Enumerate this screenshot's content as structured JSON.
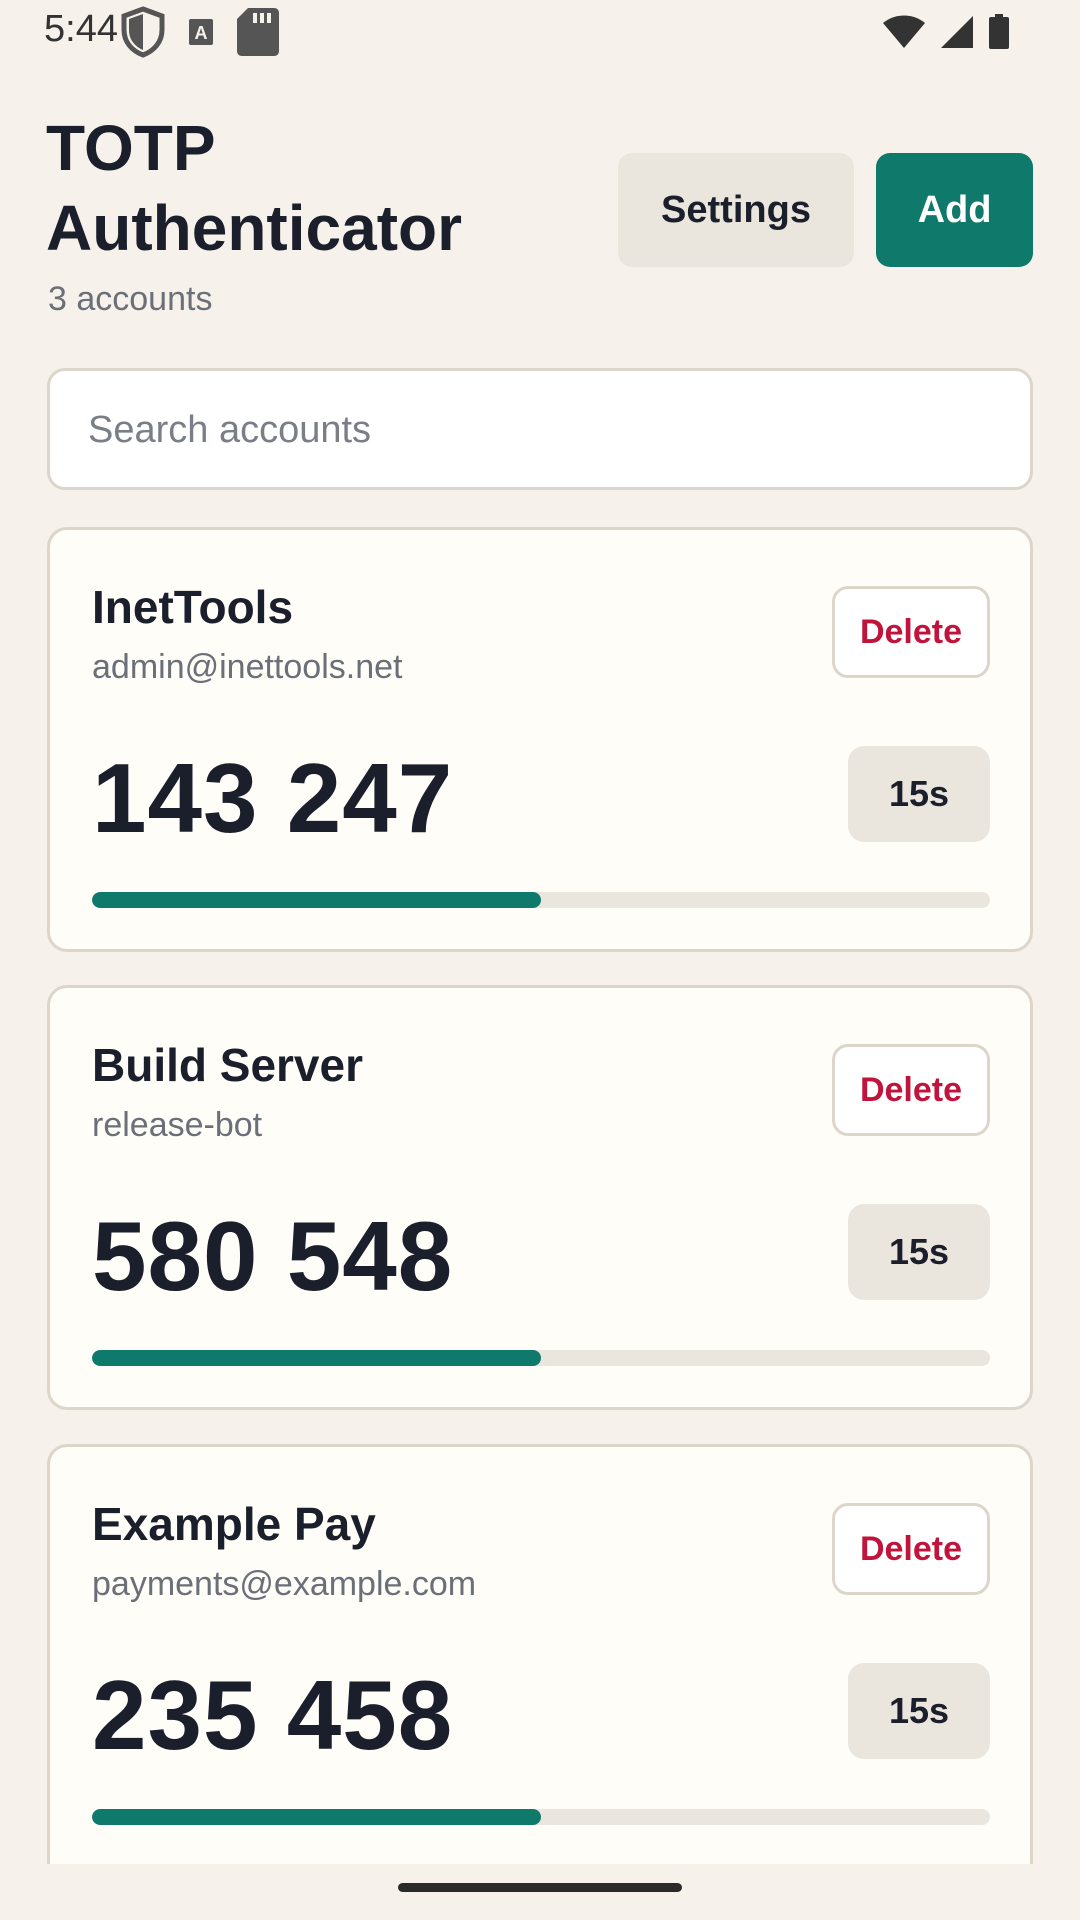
{
  "status_bar": {
    "time": "5:44",
    "left_icons": [
      "shield-icon",
      "font-a-icon",
      "sd-card-icon"
    ],
    "right_icons": [
      "wifi-icon",
      "cellular-signal-icon",
      "battery-icon"
    ]
  },
  "header": {
    "title": "TOTP Authenticator",
    "account_count": "3 accounts",
    "settings_label": "Settings",
    "add_label": "Add"
  },
  "search": {
    "placeholder": "Search accounts",
    "value": ""
  },
  "colors": {
    "background": "#f6f2eb",
    "accent": "#0f7a6c",
    "delete": "#c0143c",
    "text": "#1a1f2b",
    "muted": "#6b6f78"
  },
  "accounts": [
    {
      "issuer": "InetTools",
      "account": "admin@inettools.net",
      "code": "143 247",
      "timer": "15s",
      "progress": 0.5,
      "delete_label": "Delete"
    },
    {
      "issuer": "Build Server",
      "account": "release-bot",
      "code": "580 548",
      "timer": "15s",
      "progress": 0.5,
      "delete_label": "Delete"
    },
    {
      "issuer": "Example Pay",
      "account": "payments@example.com",
      "code": "235 458",
      "timer": "15s",
      "progress": 0.5,
      "delete_label": "Delete"
    }
  ]
}
